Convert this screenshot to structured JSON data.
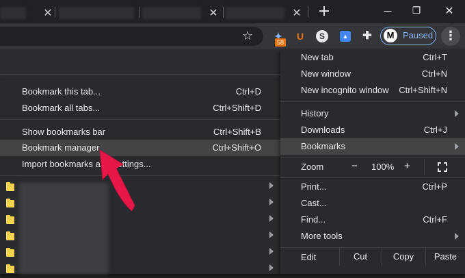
{
  "tabstrip": {
    "tabs": [
      {
        "close_glyph": "✕"
      },
      {
        "close_glyph": "✕"
      },
      {
        "close_glyph": "✕"
      }
    ],
    "new_tab_glyph": "+",
    "window_controls": {
      "minimize": "—",
      "restore": "❐",
      "close": "✕"
    }
  },
  "toolbar": {
    "star_glyph": "☆",
    "extensions": [
      {
        "icon": "bird-extension-icon",
        "glyph": "✦",
        "color": "#8ab4f8",
        "badge": "58"
      },
      {
        "icon": "u-extension-icon",
        "glyph": "U",
        "color": "#e8710a"
      },
      {
        "icon": "s-extension-icon",
        "glyph": "S",
        "color": "#e8eaed"
      },
      {
        "icon": "person-extension-icon",
        "glyph": "▲",
        "color": "#4285f4"
      },
      {
        "icon": "puzzle-icon",
        "glyph": "✚",
        "color": "#e8eaed"
      }
    ],
    "profile": {
      "avatar_letter": "M",
      "status": "Paused"
    },
    "menu_glyph": "⋮"
  },
  "bookmarks_submenu": {
    "items": [
      {
        "label": "Bookmark this tab...",
        "shortcut": "Ctrl+D"
      },
      {
        "label": "Bookmark all tabs...",
        "shortcut": "Ctrl+Shift+D"
      },
      {
        "label": "Show bookmarks bar",
        "shortcut": "Ctrl+Shift+B"
      },
      {
        "label": "Bookmark manager",
        "shortcut": "Ctrl+Shift+O"
      },
      {
        "label": "Import bookmarks and settings...",
        "shortcut": ""
      }
    ],
    "folder_count": 6
  },
  "main_menu": {
    "new_tab": {
      "label": "New tab",
      "shortcut": "Ctrl+T"
    },
    "new_window": {
      "label": "New window",
      "shortcut": "Ctrl+N"
    },
    "new_incognito": {
      "label": "New incognito window",
      "shortcut": "Ctrl+Shift+N"
    },
    "history": {
      "label": "History"
    },
    "downloads": {
      "label": "Downloads",
      "shortcut": "Ctrl+J"
    },
    "bookmarks": {
      "label": "Bookmarks"
    },
    "zoom": {
      "label": "Zoom",
      "minus": "−",
      "value": "100%",
      "plus": "+"
    },
    "print": {
      "label": "Print...",
      "shortcut": "Ctrl+P"
    },
    "cast": {
      "label": "Cast..."
    },
    "find": {
      "label": "Find...",
      "shortcut": "Ctrl+F"
    },
    "more_tools": {
      "label": "More tools"
    },
    "edit": {
      "label": "Edit",
      "cut": "Cut",
      "copy": "Copy",
      "paste": "Paste"
    }
  },
  "colors": {
    "menu_bg": "#292a2d",
    "highlight": "#434446",
    "accent_blue": "#8ab4f8",
    "arrow_red": "#e8174a"
  }
}
